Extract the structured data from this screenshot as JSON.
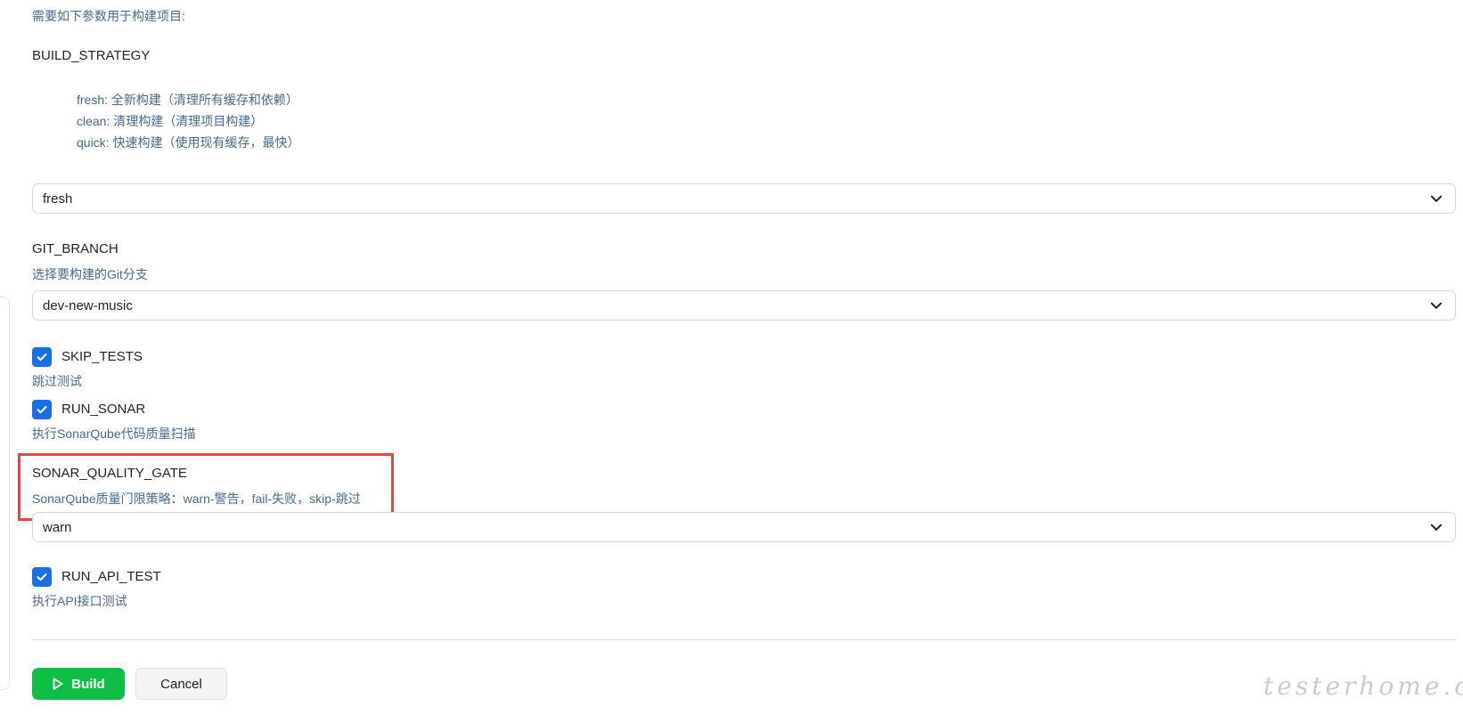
{
  "intro_text": "需要如下参数用于构建项目:",
  "build_strategy": {
    "name": "BUILD_STRATEGY",
    "options_description": [
      "fresh: 全新构建（清理所有缓存和依赖）",
      "clean: 清理构建（清理项目构建）",
      "quick: 快速构建（使用现有缓存，最快）"
    ],
    "selected": "fresh"
  },
  "git_branch": {
    "name": "GIT_BRANCH",
    "description": "选择要构建的Git分支",
    "selected": "dev-new-music"
  },
  "skip_tests": {
    "name": "SKIP_TESTS",
    "description": "跳过测试",
    "checked": true
  },
  "run_sonar": {
    "name": "RUN_SONAR",
    "description": "执行SonarQube代码质量扫描",
    "checked": true
  },
  "sonar_quality_gate": {
    "name": "SONAR_QUALITY_GATE",
    "description": "SonarQube质量门限策略：warn-警告，fail-失败，skip-跳过",
    "selected": "warn"
  },
  "run_api_test": {
    "name": "RUN_API_TEST",
    "description": "执行API接口测试",
    "checked": true
  },
  "actions": {
    "build_label": "Build",
    "cancel_label": "Cancel"
  },
  "watermark": "testerhome.com",
  "colors": {
    "accent_blue": "#1a6ee6",
    "build_green": "#0fbf45",
    "highlight_red": "#e0484a",
    "description_text": "#4a6a8e"
  },
  "icons": {
    "select_chevron": "chevron-down-icon",
    "checkbox_check": "check-icon",
    "build_icon": "play-icon"
  }
}
